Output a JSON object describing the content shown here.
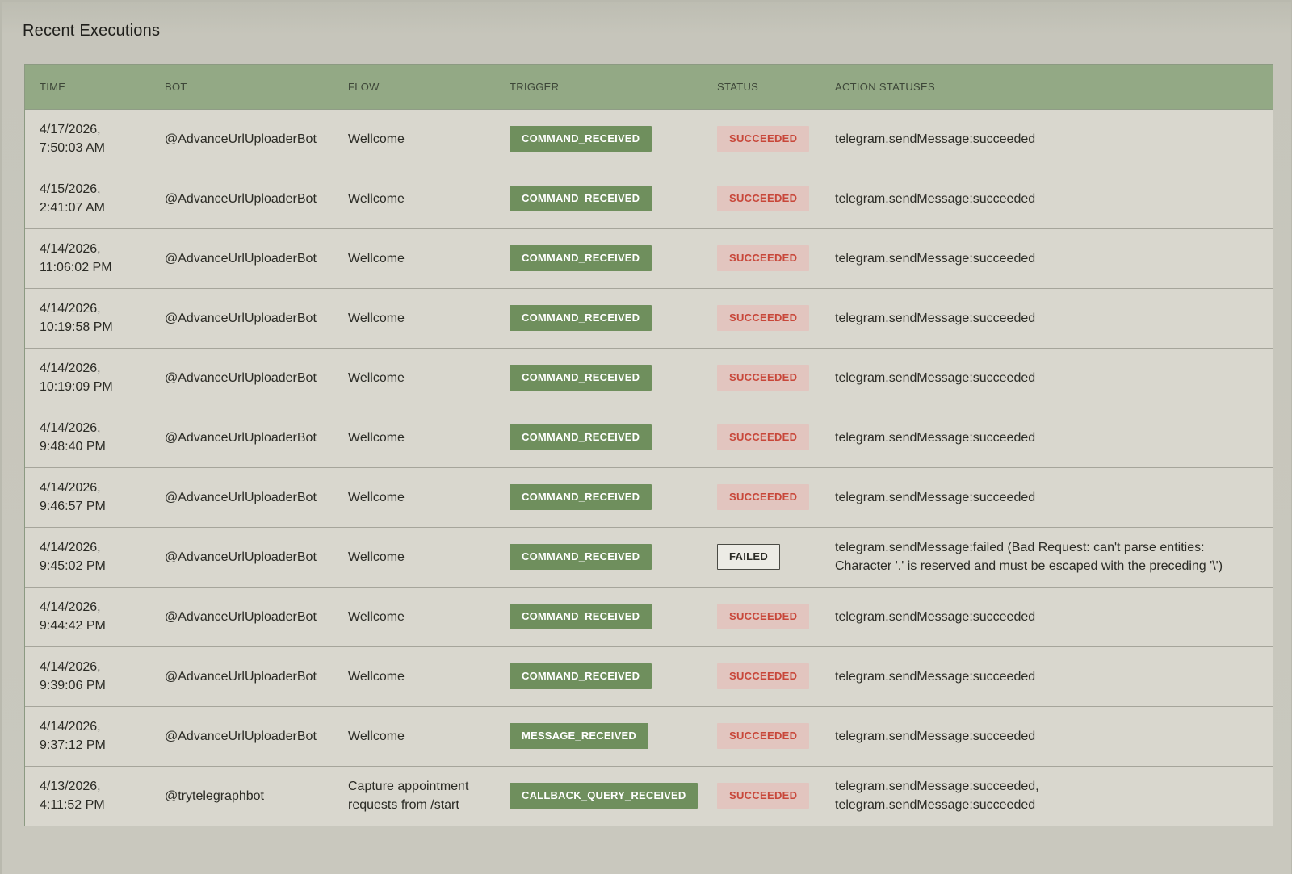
{
  "section": {
    "title": "Recent Executions"
  },
  "table": {
    "headers": [
      "TIME",
      "BOT",
      "FLOW",
      "TRIGGER",
      "STATUS",
      "ACTION STATUSES"
    ],
    "rows": [
      {
        "time": "4/17/2026,\n7:50:03 AM",
        "bot": "@AdvanceUrlUploaderBot",
        "flow": "Wellcome",
        "trigger": "COMMAND_RECEIVED",
        "status": "SUCCEEDED",
        "actions": "telegram.sendMessage:succeeded"
      },
      {
        "time": "4/15/2026,\n2:41:07 AM",
        "bot": "@AdvanceUrlUploaderBot",
        "flow": "Wellcome",
        "trigger": "COMMAND_RECEIVED",
        "status": "SUCCEEDED",
        "actions": "telegram.sendMessage:succeeded"
      },
      {
        "time": "4/14/2026,\n11:06:02 PM",
        "bot": "@AdvanceUrlUploaderBot",
        "flow": "Wellcome",
        "trigger": "COMMAND_RECEIVED",
        "status": "SUCCEEDED",
        "actions": "telegram.sendMessage:succeeded"
      },
      {
        "time": "4/14/2026,\n10:19:58 PM",
        "bot": "@AdvanceUrlUploaderBot",
        "flow": "Wellcome",
        "trigger": "COMMAND_RECEIVED",
        "status": "SUCCEEDED",
        "actions": "telegram.sendMessage:succeeded"
      },
      {
        "time": "4/14/2026,\n10:19:09 PM",
        "bot": "@AdvanceUrlUploaderBot",
        "flow": "Wellcome",
        "trigger": "COMMAND_RECEIVED",
        "status": "SUCCEEDED",
        "actions": "telegram.sendMessage:succeeded"
      },
      {
        "time": "4/14/2026,\n9:48:40 PM",
        "bot": "@AdvanceUrlUploaderBot",
        "flow": "Wellcome",
        "trigger": "COMMAND_RECEIVED",
        "status": "SUCCEEDED",
        "actions": "telegram.sendMessage:succeeded"
      },
      {
        "time": "4/14/2026,\n9:46:57 PM",
        "bot": "@AdvanceUrlUploaderBot",
        "flow": "Wellcome",
        "trigger": "COMMAND_RECEIVED",
        "status": "SUCCEEDED",
        "actions": "telegram.sendMessage:succeeded"
      },
      {
        "time": "4/14/2026,\n9:45:02 PM",
        "bot": "@AdvanceUrlUploaderBot",
        "flow": "Wellcome",
        "trigger": "COMMAND_RECEIVED",
        "status": "FAILED",
        "actions": "telegram.sendMessage:failed (Bad Request: can't parse entities:\nCharacter '.' is reserved and must be escaped with the preceding '\\')"
      },
      {
        "time": "4/14/2026,\n9:44:42 PM",
        "bot": "@AdvanceUrlUploaderBot",
        "flow": "Wellcome",
        "trigger": "COMMAND_RECEIVED",
        "status": "SUCCEEDED",
        "actions": "telegram.sendMessage:succeeded"
      },
      {
        "time": "4/14/2026,\n9:39:06 PM",
        "bot": "@AdvanceUrlUploaderBot",
        "flow": "Wellcome",
        "trigger": "COMMAND_RECEIVED",
        "status": "SUCCEEDED",
        "actions": "telegram.sendMessage:succeeded"
      },
      {
        "time": "4/14/2026,\n9:37:12 PM",
        "bot": "@AdvanceUrlUploaderBot",
        "flow": "Wellcome",
        "trigger": "MESSAGE_RECEIVED",
        "status": "SUCCEEDED",
        "actions": "telegram.sendMessage:succeeded"
      },
      {
        "time": "4/13/2026,\n4:11:52 PM",
        "bot": "@trytelegraphbot",
        "flow": "Capture appointment\nrequests from /start",
        "trigger": "CALLBACK_QUERY_RECEIVED",
        "status": "SUCCEEDED",
        "actions": "telegram.sendMessage:succeeded,\ntelegram.sendMessage:succeeded"
      }
    ]
  },
  "colors": {
    "header_bg": "#93a985",
    "trigger_badge": "#6f8f5d",
    "status_ok_bg": "#e2c5bf",
    "status_ok_text": "#c8473a"
  }
}
